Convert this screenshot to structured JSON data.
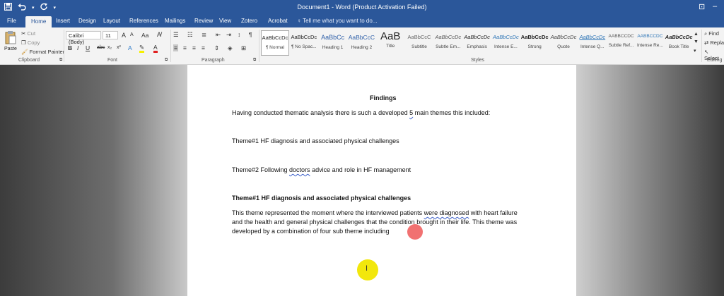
{
  "window": {
    "title": "Document1 - Word (Product Activation Failed)"
  },
  "quick_access": {
    "save_icon": "save-icon",
    "undo_icon": "undo-icon",
    "redo_icon": "redo-icon"
  },
  "tabs": [
    "File",
    "Home",
    "Insert",
    "Design",
    "Layout",
    "References",
    "Mailings",
    "Review",
    "View",
    "Zotero",
    "Acrobat"
  ],
  "tell_me": "Tell me what you want to do...",
  "clipboard": {
    "paste": "Paste",
    "cut": "Cut",
    "copy": "Copy",
    "format_painter": "Format Painter",
    "label": "Clipboard"
  },
  "font": {
    "name": "Calibri (Body)",
    "size": "11",
    "grow": "A",
    "shrink": "A",
    "change_case": "Aa",
    "bold": "B",
    "italic": "I",
    "underline": "U",
    "strike": "abc",
    "subscript": "x₂",
    "superscript": "x²",
    "font_color": "A",
    "label": "Font"
  },
  "paragraph": {
    "label": "Paragraph",
    "pilcrow": "¶"
  },
  "styles": {
    "label": "Styles",
    "items": [
      {
        "preview": "AaBbCcDc",
        "name": "¶ Normal"
      },
      {
        "preview": "AaBbCcDc",
        "name": "¶ No Spac..."
      },
      {
        "preview": "AaBbCc",
        "name": "Heading 1"
      },
      {
        "preview": "AaBbCcC",
        "name": "Heading 2"
      },
      {
        "preview": "AaB",
        "name": "Title"
      },
      {
        "preview": "AaBbCcC",
        "name": "Subtitle"
      },
      {
        "preview": "AaBbCcDc",
        "name": "Subtle Em..."
      },
      {
        "preview": "AaBbCcDc",
        "name": "Emphasis"
      },
      {
        "preview": "AaBbCcDc",
        "name": "Intense E..."
      },
      {
        "preview": "AaBbCcDc",
        "name": "Strong"
      },
      {
        "preview": "AaBbCcDc",
        "name": "Quote"
      },
      {
        "preview": "AaBbCcDc",
        "name": "Intense Q..."
      },
      {
        "preview": "AABBCCDC",
        "name": "Subtle Ref..."
      },
      {
        "preview": "AABBCCDC",
        "name": "Intense Re..."
      },
      {
        "preview": "AaBbCcDc",
        "name": "Book Title"
      }
    ]
  },
  "editing": {
    "label": "Editing",
    "find": "Find",
    "replace": "Repla",
    "select": "Select"
  },
  "document": {
    "heading": "Findings",
    "intro_before": "Having conducted thematic analysis there is such a developed ",
    "intro_five": "5",
    "intro_after": " main themes this included:",
    "theme1": "Theme#1 HF diagnosis and associated physical challenges",
    "theme2_before": "Theme#2 Following ",
    "theme2_doctors": "doctors",
    "theme2_after": " advice and role in HF management",
    "theme1_heading": "Theme#1 HF diagnosis and associated physical challenges",
    "body_line1_before": "This theme represented the moment where the interviewed patients ",
    "body_line1_were": "were diagnosed",
    "body_line1_after": " with heart failure",
    "body_line2": "and the health and general physical challenges that the condition brought in their life. This theme was",
    "body_line3": "developed by a combination of four sub theme including"
  },
  "colors": {
    "word_blue": "#2b579a",
    "click_marker": "#f06262",
    "cursor_highlight": "#f2e70c"
  }
}
